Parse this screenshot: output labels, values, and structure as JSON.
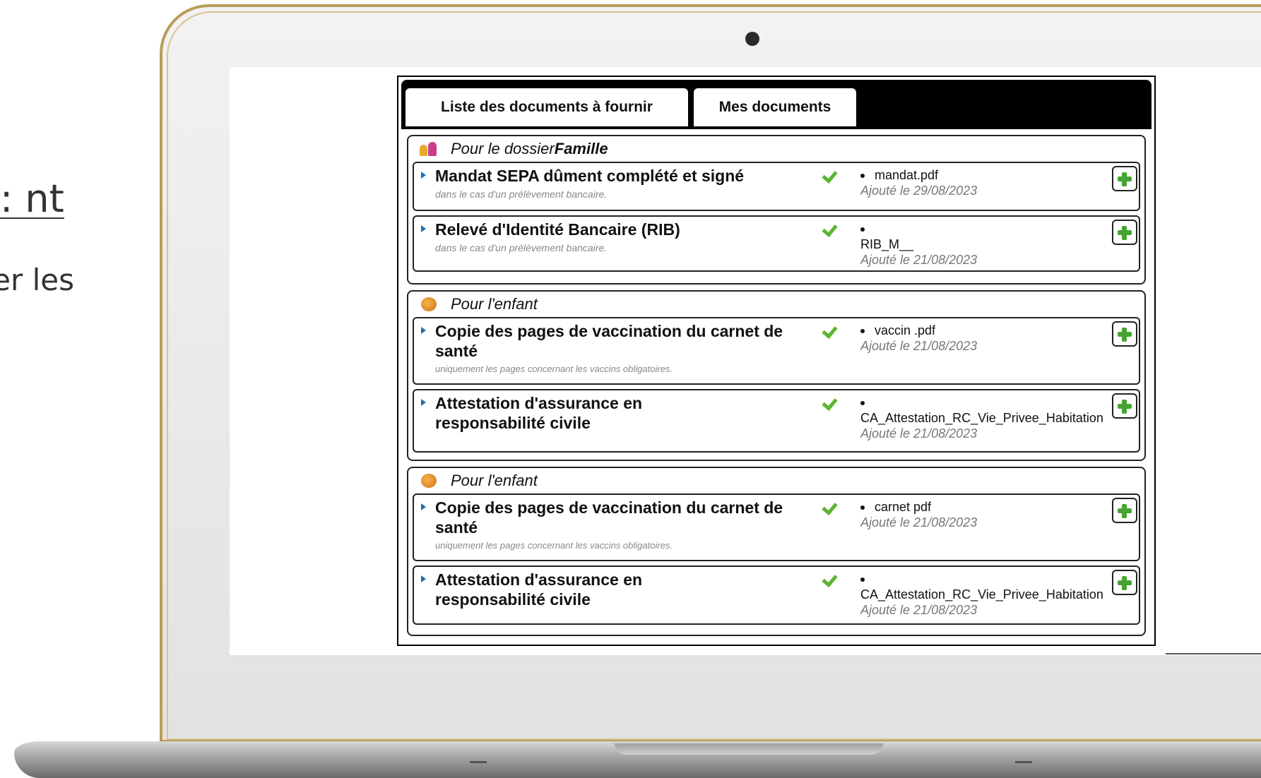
{
  "slide": {
    "heading_fragment": "nt :",
    "sub_fragment": "er les"
  },
  "tabs": [
    {
      "label": "Liste des documents à fournir"
    },
    {
      "label": "Mes documents"
    }
  ],
  "groups": [
    {
      "heading_prefix": "Pour le dossier ",
      "heading_bold": "Famille",
      "icon": "family-icon",
      "items": [
        {
          "title": "Mandat SEPA dûment complété et signé",
          "note": "dans le cas d'un prélèvement bancaire.",
          "file": "mandat.pdf",
          "date": "Ajouté le 29/08/2023"
        },
        {
          "title": "Relevé d'Identité Bancaire (RIB)",
          "note": "dans le cas d'un prélèvement bancaire.",
          "file": "RIB_M__",
          "date": "Ajouté le 21/08/2023"
        }
      ]
    },
    {
      "heading_prefix": "Pour l'enfant",
      "icon": "child-icon",
      "items": [
        {
          "title": "Copie des pages de vaccination du carnet de santé",
          "note": "uniquement les pages concernant les vaccins obligatoires.",
          "file": "vaccin    .pdf",
          "date": "Ajouté le 21/08/2023"
        },
        {
          "title": "Attestation d'assurance en responsabilité civile",
          "file": "CA_Attestation_RC_Vie_Privee_Habitation",
          "date": "Ajouté le 21/08/2023"
        }
      ]
    },
    {
      "heading_prefix": "Pour l'enfant",
      "icon": "child-icon",
      "items": [
        {
          "title": "Copie des pages de vaccination du carnet de santé",
          "note": "uniquement les pages concernant les vaccins obligatoires.",
          "file": "carnet      pdf",
          "date": "Ajouté le 21/08/2023"
        },
        {
          "title": "Attestation d'assurance en responsabilité civile",
          "file": "CA_Attestation_RC_Vie_Privee_Habitation",
          "date": "Ajouté le 21/08/2023"
        }
      ]
    }
  ]
}
